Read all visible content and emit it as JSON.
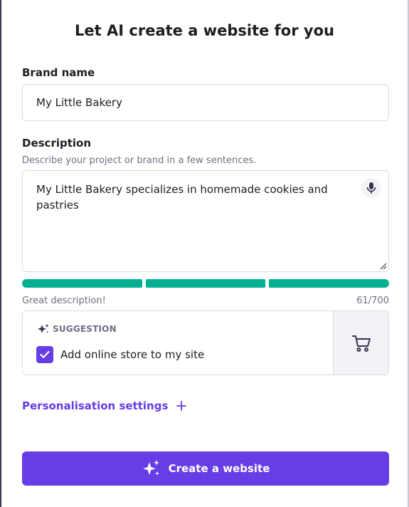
{
  "dialog": {
    "title": "Let AI create a website for you"
  },
  "brand": {
    "label": "Brand name",
    "value": "My Little Bakery"
  },
  "description": {
    "label": "Description",
    "helper": "Describe your project or brand in a few sentences.",
    "value": "My Little Bakery specializes in homemade cookies and pastries",
    "quality_text": "Great description!",
    "counter": "61/700",
    "quality_segments_filled": 3,
    "quality_segments_total": 3
  },
  "suggestion": {
    "tag": "SUGGESTION",
    "text": "Add online store to my site",
    "checked": true
  },
  "personalisation": {
    "label": "Personalisation settings",
    "icon": "plus-icon"
  },
  "cta": {
    "label": "Create a website",
    "icon": "sparkle-icon"
  },
  "colors": {
    "accent": "#673de6",
    "success": "#00b090"
  }
}
